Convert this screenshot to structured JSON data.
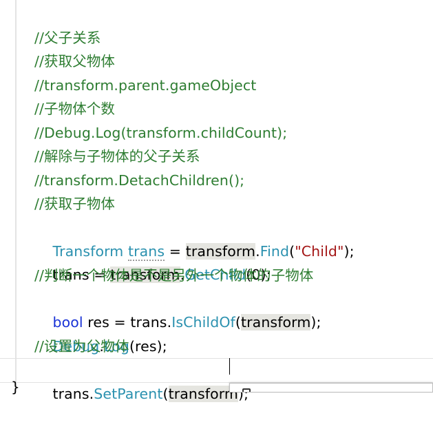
{
  "editor": {
    "lines": [
      {
        "kind": "comment",
        "text": "//父子关系"
      },
      {
        "kind": "comment",
        "text": "//获取父物体"
      },
      {
        "kind": "comment",
        "text": "//transform.parent.gameObject"
      },
      {
        "kind": "comment",
        "text": "//子物体个数"
      },
      {
        "kind": "comment",
        "text": "//Debug.Log(transform.childCount);"
      },
      {
        "kind": "comment",
        "text": "//解除与子物体的父子关系"
      },
      {
        "kind": "comment",
        "text": "//transform.DetachChildren();"
      },
      {
        "kind": "comment",
        "text": "//获取子物体"
      },
      {
        "kind": "code",
        "tokens": {
          "t1": "Transform",
          "t2": " ",
          "t3": "trans",
          "t4": " = ",
          "t5": "transform",
          "t6": ".",
          "t7": "Find",
          "t8": "(",
          "t9": "\"Child\"",
          "t10": ");"
        }
      },
      {
        "kind": "code",
        "tokens": {
          "t1": "trans = ",
          "t2": "transform",
          "t3": ".",
          "t4": "GetChild",
          "t5": "(0);"
        }
      },
      {
        "kind": "comment",
        "text": "//判断一个物体是不是另外一个物体的子物体"
      },
      {
        "kind": "code",
        "tokens": {
          "t1": "bool",
          "t2": " res = trans.",
          "t3": "IsChildOf",
          "t4": "(",
          "t5": "transform",
          "t6": ");"
        }
      },
      {
        "kind": "code",
        "tokens": {
          "t1": "Debug",
          "t2": ".",
          "t3": "Log",
          "t4": "(res);"
        }
      },
      {
        "kind": "comment",
        "text": "//设置为父物体"
      },
      {
        "kind": "code",
        "tokens": {
          "t1": "trans.",
          "t2": "SetParent",
          "t3": "(",
          "t4": "transform",
          "t5": ");"
        }
      }
    ],
    "closing_brace": "}"
  },
  "colors": {
    "comment": "#2e7d32",
    "type": "#2b91af",
    "keyword": "#1a33d6",
    "string": "#a31515",
    "highlight": "#e5e5e0"
  }
}
